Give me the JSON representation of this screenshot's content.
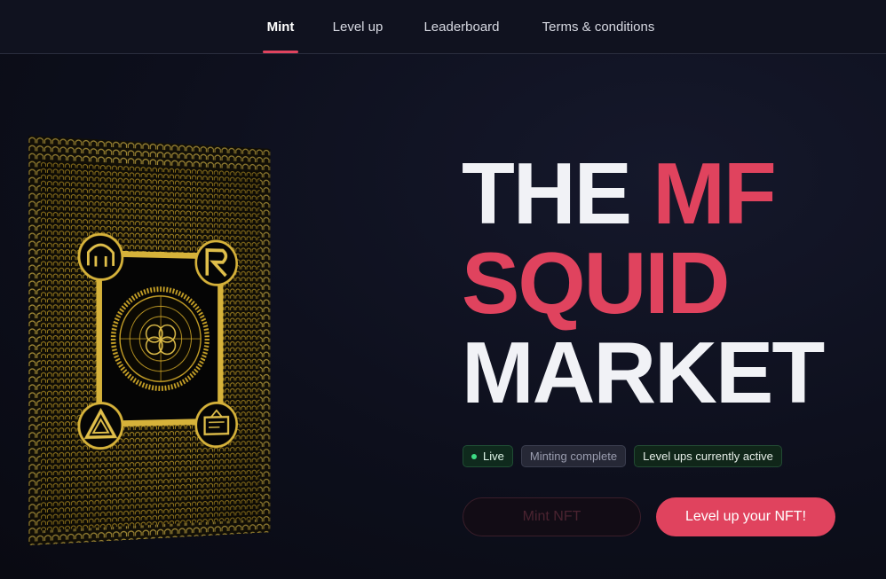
{
  "nav": {
    "items": [
      {
        "label": "Mint",
        "active": true
      },
      {
        "label": "Level up",
        "active": false
      },
      {
        "label": "Leaderboard",
        "active": false
      },
      {
        "label": "Terms & conditions",
        "active": false
      }
    ]
  },
  "hero": {
    "line1_white": "THE ",
    "line1_red": "MF",
    "line2_red": "SQUID",
    "line3_white": "MARKET"
  },
  "badges": {
    "live": "Live",
    "minting": "Minting complete",
    "level_ups": "Level ups currently active"
  },
  "buttons": {
    "mint": "Mint NFT",
    "level_up": "Level up your NFT!"
  },
  "colors": {
    "accent": "#e0435e",
    "live_dot": "#3ddc84",
    "card_gold": "#c9a227",
    "background": "#0d0f1c"
  },
  "icons": {
    "card_corners": [
      "squid-logo-icon",
      "r-logo-icon",
      "triangle-logo-icon",
      "tv-logo-icon"
    ],
    "card_center": "circular-seal-icon"
  }
}
